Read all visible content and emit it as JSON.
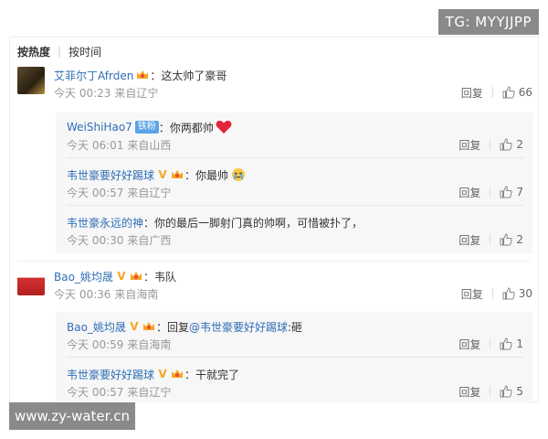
{
  "watermark_top": "TG: MYYJJPP",
  "watermark_bottom": "www.zy-water.cn",
  "sortbar": {
    "hot": "按热度",
    "sep": "|",
    "time": "按时间"
  },
  "common": {
    "reply": "回复"
  },
  "comments": [
    {
      "user": "艾菲尔丁Afrden",
      "text": "这太帅了豪哥",
      "time": "今天 00:23",
      "location": "来自辽宁",
      "likes": "66",
      "replies": [
        {
          "user": "WeiShiHao7",
          "badge": "铁粉",
          "text": "你两都帅",
          "time": "今天 06:01",
          "location": "来自山西",
          "likes": "2"
        },
        {
          "user": "韦世豪要好好踢球",
          "text": "你最帅",
          "time": "今天 00:57",
          "location": "来自辽宁",
          "likes": "7"
        },
        {
          "user": "韦世豪永远的神",
          "text": "你的最后一脚射门真的帅啊，可惜被扑了，",
          "time": "今天 00:30",
          "location": "来自广西",
          "likes": "2"
        }
      ]
    },
    {
      "user": "Bao_姚均晟",
      "text": "韦队",
      "time": "今天 00:36",
      "location": "来自海南",
      "likes": "30",
      "replies": [
        {
          "user": "Bao_姚均晟",
          "text_prefix": "回复",
          "mention": "@韦世豪要好好踢球",
          "text": ":砸",
          "time": "今天 00:59",
          "location": "来自海南",
          "likes": "1"
        },
        {
          "user": "韦世豪要好好踢球",
          "text": "干就完了",
          "time": "今天 00:57",
          "location": "来自辽宁",
          "likes": "5"
        }
      ]
    }
  ],
  "colors": {
    "link": "#2f6eb5",
    "meta": "#999999",
    "badge_v": "#f5a623",
    "fan_badge": "#5aa3e6",
    "heart": "#e0243a"
  }
}
